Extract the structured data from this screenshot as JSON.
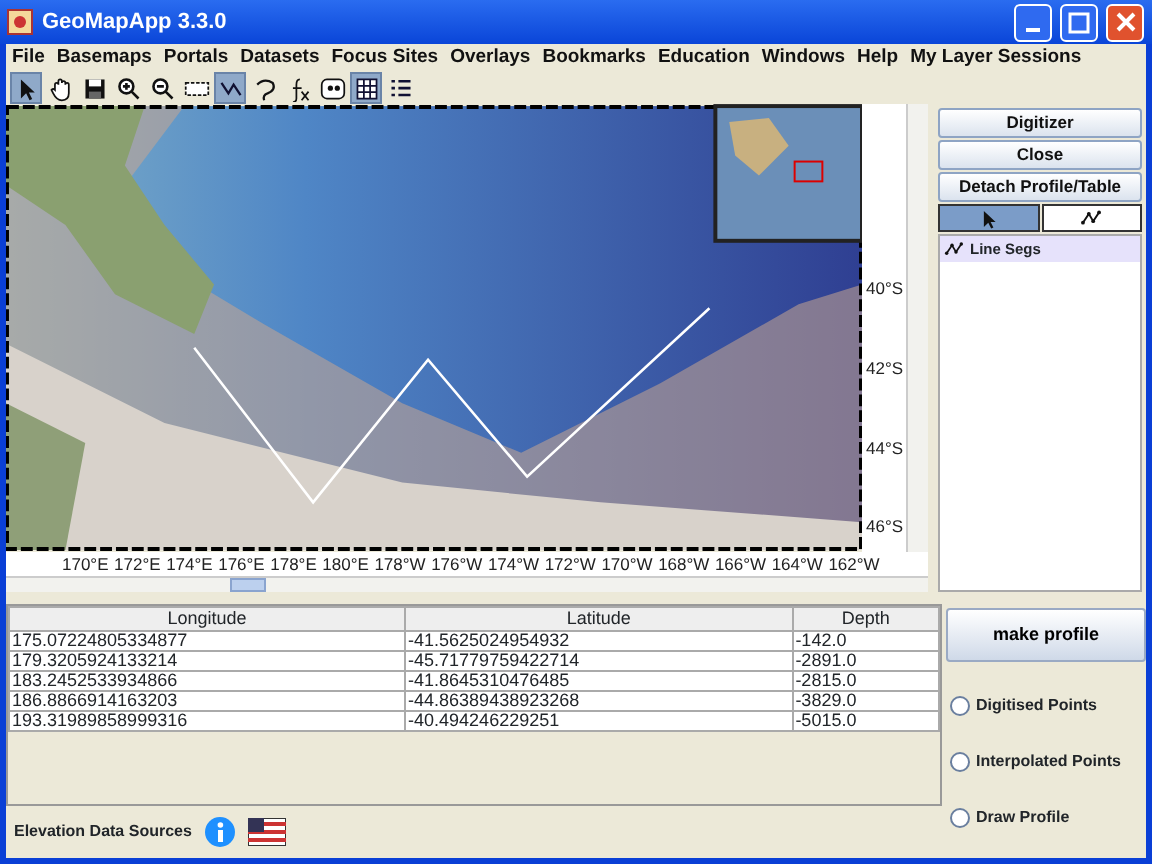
{
  "window": {
    "title": "GeoMapApp 3.3.0"
  },
  "menu": [
    "File",
    "Basemaps",
    "Portals",
    "Datasets",
    "Focus Sites",
    "Overlays",
    "Bookmarks",
    "Education",
    "Windows",
    "Help",
    "My Layer Sessions"
  ],
  "toolbar": [
    {
      "kind": "pointer",
      "selected": true
    },
    {
      "kind": "hand",
      "selected": false
    },
    {
      "kind": "save",
      "selected": false
    },
    {
      "kind": "zoomin",
      "selected": false
    },
    {
      "kind": "zoomout",
      "selected": false
    },
    {
      "kind": "rect",
      "selected": false
    },
    {
      "kind": "profile",
      "selected": true
    },
    {
      "kind": "lasso",
      "selected": false
    },
    {
      "kind": "fx",
      "selected": false
    },
    {
      "kind": "blob",
      "selected": false
    },
    {
      "kind": "grid",
      "selected": true
    },
    {
      "kind": "list",
      "selected": false
    }
  ],
  "map": {
    "lat_labels": [
      "40°S",
      "42°S",
      "44°S",
      "46°S"
    ],
    "lon_labels": [
      "170°E",
      "172°E",
      "174°E",
      "176°E",
      "178°E",
      "180°E",
      "178°W",
      "176°W",
      "174°W",
      "172°W",
      "170°W",
      "168°W",
      "166°W",
      "164°W",
      "162°W"
    ]
  },
  "digitizer": {
    "title": "Digitizer",
    "buttons": [
      "Close",
      "Detach Profile/Table"
    ],
    "tools": [
      {
        "kind": "pointer",
        "selected": true
      },
      {
        "kind": "segments",
        "selected": false
      }
    ],
    "layers": [
      {
        "label": "Line Segs",
        "selected": true
      }
    ]
  },
  "table": {
    "columns": [
      "Longitude",
      "Latitude",
      "Depth"
    ],
    "rows": [
      [
        "175.07224805334877",
        "-41.5625024954932",
        "-142.0"
      ],
      [
        "179.3205924133214",
        "-45.71779759422714",
        "-2891.0"
      ],
      [
        "183.2452533934866",
        "-41.8645310476485",
        "-2815.0"
      ],
      [
        "186.8866914163203",
        "-44.86389438923268",
        "-3829.0"
      ],
      [
        "193.31989858999316",
        "-40.494246229251",
        "-5015.0"
      ]
    ]
  },
  "profile_panel": {
    "button": "make profile",
    "options": [
      {
        "label": "Digitised Points",
        "selected": false
      },
      {
        "label": "Interpolated Points",
        "selected": false
      },
      {
        "label": "Draw Profile",
        "selected": false
      }
    ]
  },
  "status_bar": {
    "label": "Elevation Data Sources"
  }
}
